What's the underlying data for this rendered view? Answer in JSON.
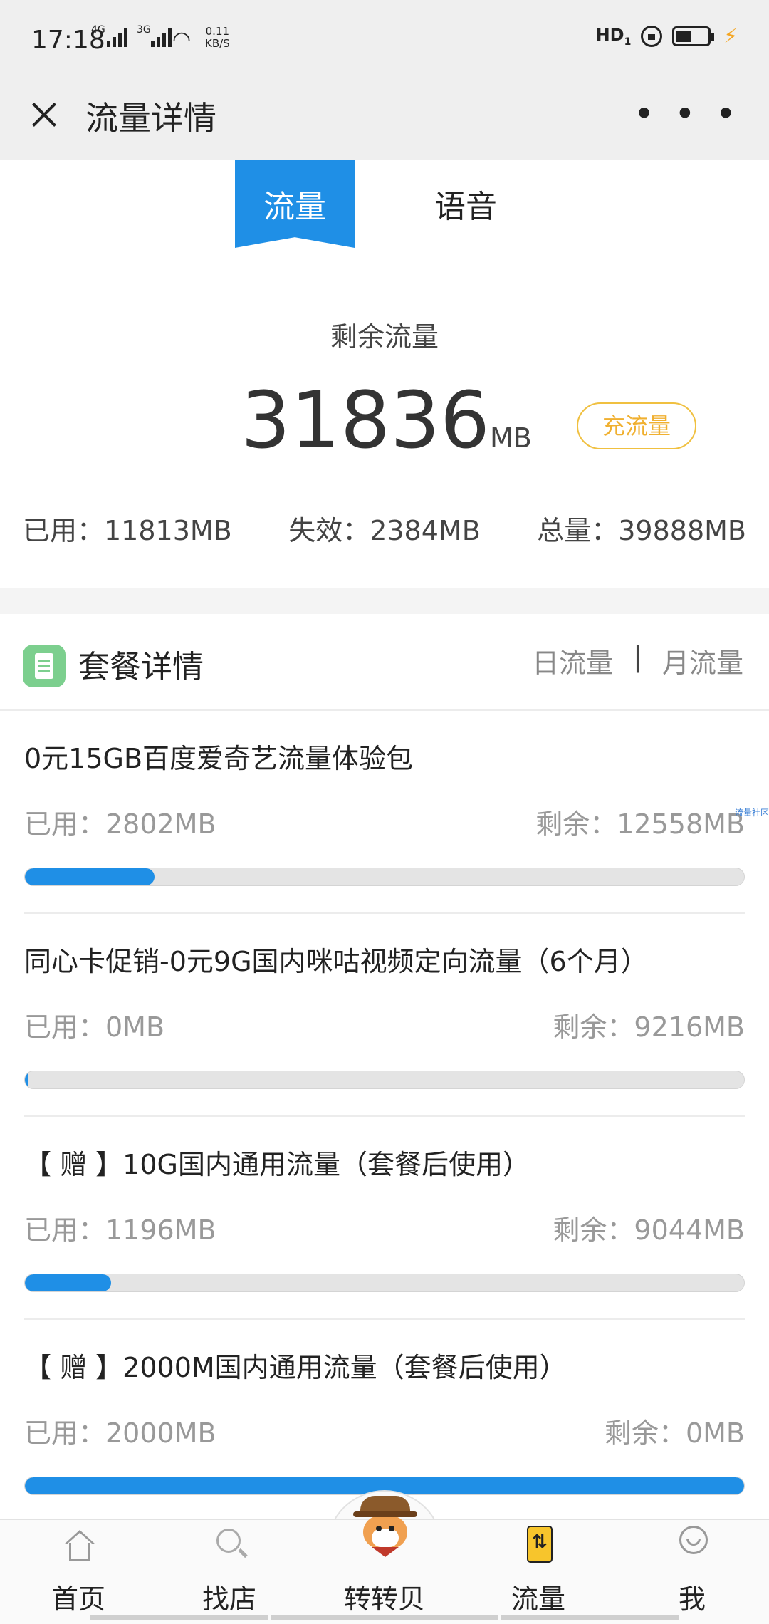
{
  "status_bar": {
    "time": "17:18",
    "net1": "4G",
    "net2": "3G",
    "speed_value": "0.11",
    "speed_unit": "KB/S",
    "hd": "HD",
    "hd_sub": "1"
  },
  "header": {
    "title": "流量详情",
    "more": "• • •"
  },
  "tabs": {
    "active": "流量",
    "inactive": "语音"
  },
  "summary": {
    "remaining_label": "剩余流量",
    "remaining_value": "31836",
    "remaining_unit": "MB",
    "recharge_button": "充流量",
    "used": "已用：11813MB",
    "expired": "失效：2384MB",
    "total": "总量：39888MB"
  },
  "packages": {
    "title": "套餐详情",
    "switch_daily": "日流量",
    "switch_sep": "|",
    "switch_monthly": "月流量",
    "items": [
      {
        "name": "0元15GB百度爱奇艺流量体验包",
        "used": "已用：2802MB",
        "remain": "剩余：12558MB",
        "progress": 0.18
      },
      {
        "name": "同心卡促销-0元9G国内咪咕视频定向流量（6个月）",
        "used": "已用：0MB",
        "remain": "剩余：9216MB",
        "progress": 0.005
      },
      {
        "name": "【 赠 】10G国内通用流量（套餐后使用）",
        "used": "已用：1196MB",
        "remain": "剩余：9044MB",
        "progress": 0.12
      },
      {
        "name": "【 赠 】2000M国内通用流量（套餐后使用）",
        "used": "已用：2000MB",
        "remain": "剩余：0MB",
        "progress": 1.0
      }
    ]
  },
  "watermark": "流量社区",
  "bottom_nav": {
    "home": "首页",
    "shop": "找店",
    "mascot": "转转贝",
    "flow": "流量",
    "me": "我"
  },
  "colors": {
    "accent": "#1f8fe6",
    "recharge": "#f0b030",
    "package_icon": "#7ccf8e"
  },
  "icons": [
    "close-icon",
    "more-icon",
    "document-icon",
    "home-icon",
    "search-icon",
    "mascot-icon",
    "flow-card-icon",
    "user-icon"
  ]
}
